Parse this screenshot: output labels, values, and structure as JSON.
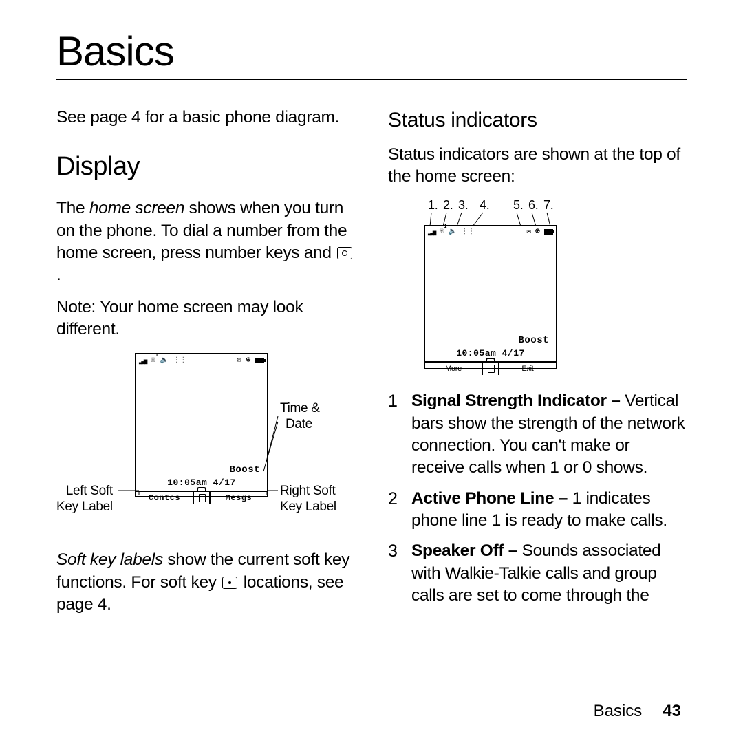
{
  "title": "Basics",
  "leftCol": {
    "intro": "See page 4 for a basic phone diagram.",
    "displayHeading": "Display",
    "displayP1_a": "The ",
    "displayP1_italic": "home screen",
    "displayP1_b": " shows when you turn on the phone. To dial a number from the home screen, press number keys and ",
    "displayP1_c": ".",
    "displayP2": "Note: Your home screen may look different.",
    "softkey_a": "Soft key labels",
    "softkey_b": " show the current soft key functions. For soft key ",
    "softkey_c": " locations, see page 4."
  },
  "phone1": {
    "carrier": "Boost",
    "datetime": "10:05am  4/17",
    "leftSoft": "Contcs",
    "rightSoft": "Mesgs",
    "callouts": {
      "timeDate_a": "Time &",
      "timeDate_b": "Date",
      "leftSoft_a": "Left Soft",
      "leftSoft_b": "Key Label",
      "rightSoft_a": "Right Soft",
      "rightSoft_b": "Key Label"
    }
  },
  "rightCol": {
    "subheading": "Status indicators",
    "statusP": "Status indicators are shown at the top of the home screen:"
  },
  "phone2": {
    "carrier": "Boost",
    "datetime": "10:05am  4/17",
    "leftSoft": "More",
    "rightSoft": "Exit",
    "numbers": [
      "1.",
      "2.",
      "3.",
      "4.",
      "5.",
      "6.",
      "7."
    ]
  },
  "indicators": [
    {
      "n": "1",
      "bold": "Signal Strength Indicator –",
      "rest": " Vertical bars show the strength of the network connection. You can't make or receive calls when 1  or 0     shows."
    },
    {
      "n": "2",
      "bold": "Active Phone Line –",
      "rest": " 1 indicates phone line 1 is ready to make calls."
    },
    {
      "n": "3",
      "bold": "Speaker Off –",
      "rest": " Sounds associated with Walkie-Talkie calls and group calls are set to come through the"
    }
  ],
  "footer": {
    "section": "Basics",
    "page": "43"
  }
}
